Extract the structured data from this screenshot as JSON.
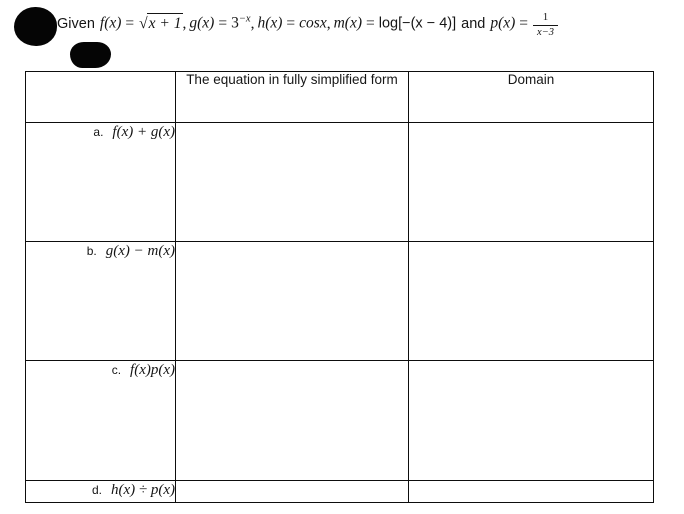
{
  "prompt": {
    "lead": "Given",
    "f_name": "f",
    "f_arg": "(x)",
    "eq": "=",
    "sqrt_radicand": "x + 1",
    "comma1": ",",
    "g_name": "g",
    "g_arg": "(x)",
    "g_base": "3",
    "g_exponent": "−x",
    "comma2": ",",
    "h_name": "h",
    "h_arg": "(x)",
    "h_value": "cosx",
    "comma3": ",",
    "m_name": "m",
    "m_arg": "(x)",
    "m_value": "log[−(x − 4)]",
    "and": "and",
    "p_name": "p",
    "p_arg": "(x)",
    "p_numerator": "1",
    "p_denominator": "x−3",
    "full_text": "Given f(x) = √(x + 1), g(x) = 3⁻ˣ, h(x) = cosx, m(x) = log[−(x − 4)] and p(x) = 1/(x−3)"
  },
  "table": {
    "headers": {
      "label_column": "",
      "equation_column": "The equation in fully simplified form",
      "domain_column": "Domain"
    },
    "rows": [
      {
        "letter": "a.",
        "expression": "f(x) + g(x)",
        "equation_answer": "",
        "domain_answer": ""
      },
      {
        "letter": "b.",
        "expression": "g(x) − m(x)",
        "equation_answer": "",
        "domain_answer": ""
      },
      {
        "letter": "c.",
        "expression": "f(x)p(x)",
        "equation_answer": "",
        "domain_answer": ""
      },
      {
        "letter": "d.",
        "expression": "h(x) ÷ p(x)",
        "equation_answer": "",
        "domain_answer": ""
      }
    ]
  },
  "annotations": {
    "redaction_upper": "black-ellipse-redaction",
    "redaction_lower": "black-rounded-redaction"
  },
  "colors": {
    "page_background": "#ffffff",
    "text": "#151515",
    "table_border": "#0d0d0d",
    "redaction": "#050505"
  }
}
